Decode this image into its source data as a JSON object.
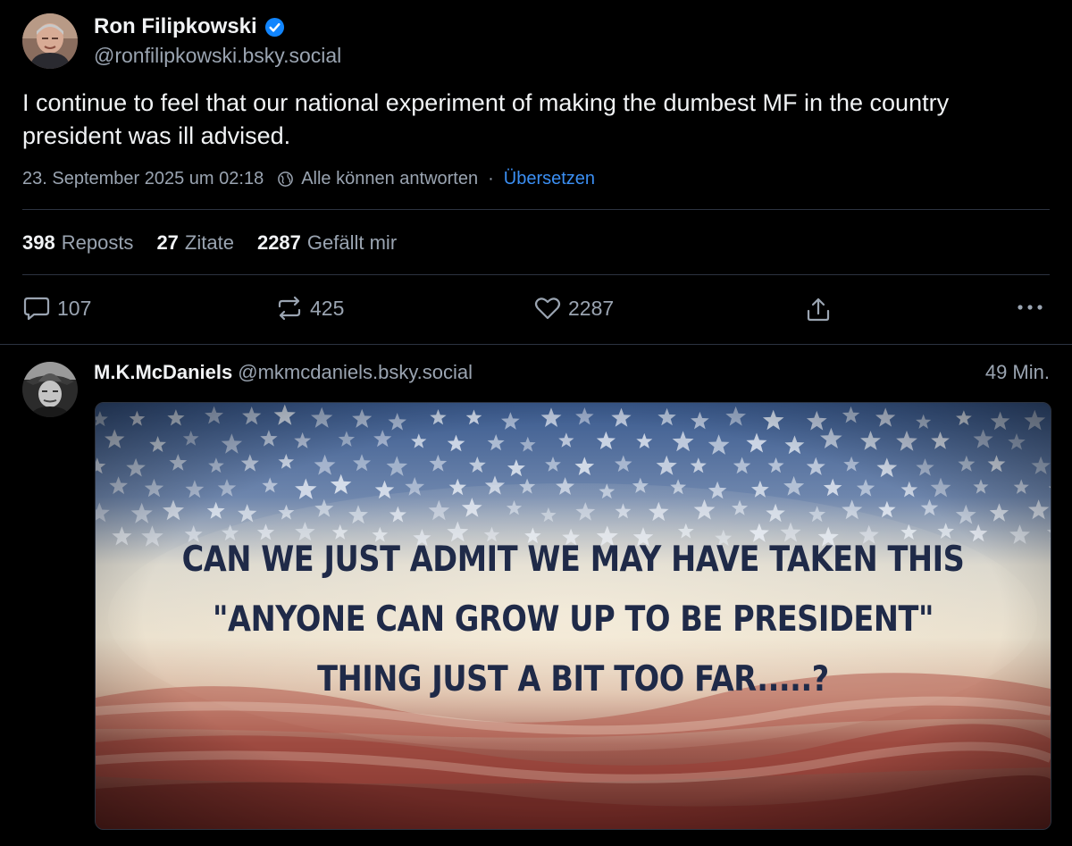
{
  "main_post": {
    "author": {
      "display_name": "Ron Filipkowski",
      "handle": "@ronfilipkowski.bsky.social",
      "verified": true
    },
    "text": "I continue to feel that our national experiment of making the dumbest MF in the country president was ill advised.",
    "meta": {
      "timestamp": "23. September 2025 um 02:18",
      "reply_setting": "Alle können antworten",
      "separator": "·",
      "translate": "Übersetzen"
    },
    "stats": {
      "reposts_count": "398",
      "reposts_label": "Reposts",
      "quotes_count": "27",
      "quotes_label": "Zitate",
      "likes_count": "2287",
      "likes_label": "Gefällt mir"
    },
    "actions": {
      "reply_count": "107",
      "repost_count": "425",
      "like_count": "2287"
    }
  },
  "reply": {
    "display_name": "M.K.McDaniels",
    "handle": "@mkmcdaniels.bsky.social",
    "time": "49 Min.",
    "image_text": [
      "CAN WE JUST ADMIT WE MAY HAVE TAKEN THIS",
      "\"ANYONE CAN GROW UP TO BE PRESIDENT\"",
      "THING JUST A BIT TOO FAR.....?"
    ]
  },
  "icons": {
    "verified": "verified-badge-icon",
    "globe": "globe-icon",
    "reply": "speech-bubble-icon",
    "repost": "repost-arrows-icon",
    "like": "heart-icon",
    "share": "share-upload-icon",
    "more": "ellipsis-icon"
  },
  "colors": {
    "background": "#000000",
    "text_primary": "#f1f3f5",
    "text_secondary": "#9aa4b1",
    "accent": "#3b8ff3",
    "divider": "#2c3340"
  }
}
